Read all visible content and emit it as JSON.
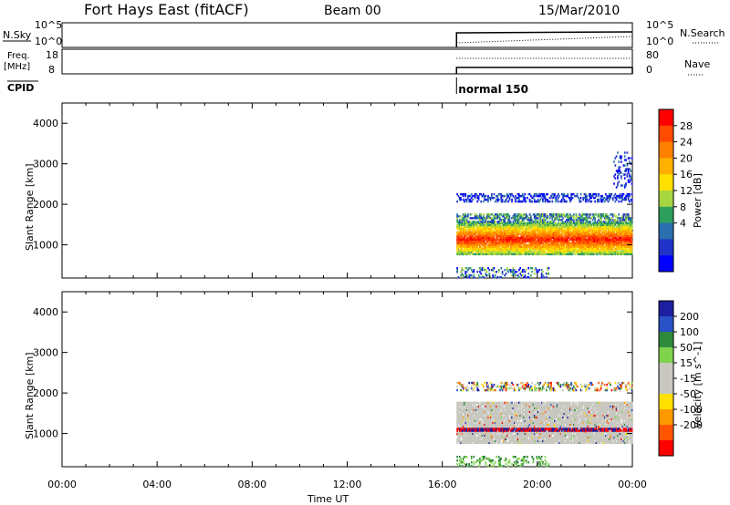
{
  "header": {
    "station": "Fort Hays East (fitACF)",
    "beam": "Beam 00",
    "date": "15/Mar/2010"
  },
  "status": {
    "nsky_label": "N.Sky",
    "nsky_ticks": [
      "10^5",
      "10^0"
    ],
    "nsearch_label": "N.Search",
    "nsearch_ticks": [
      "10^5",
      "10^0"
    ],
    "freq_label_top": "Freq.",
    "freq_label_bottom": "[MHz]",
    "freq_ticks": [
      "18",
      "8"
    ],
    "nave_label": "Nave",
    "nave_ticks": [
      "80",
      "0"
    ],
    "cpid_label": "CPID",
    "cpid_text": "normal 150",
    "cpid_start_hour": 16.6
  },
  "axes": {
    "y_label": "Slant Range [km]",
    "y_ticks": [
      1000,
      2000,
      3000,
      4000
    ],
    "y_range": [
      180,
      4500
    ],
    "x_label": "Time UT",
    "x_ticks": [
      "00:00",
      "04:00",
      "08:00",
      "12:00",
      "16:00",
      "20:00",
      "00:00"
    ],
    "x_range_hours": [
      0,
      24
    ]
  },
  "power_scale": {
    "label": "Power [dB]",
    "ticks": [
      "28",
      "24",
      "20",
      "16",
      "12",
      "8",
      "4"
    ],
    "colors": [
      "#ff0000",
      "#ff4a00",
      "#ff8000",
      "#ffb000",
      "#ffe000",
      "#a6d640",
      "#2e9e5e",
      "#2a6fae",
      "#2032c8",
      "#0000ff"
    ]
  },
  "velocity_scale": {
    "label": "Velocity [m s^-1]",
    "ticks": [
      "200",
      "100",
      "50",
      "15",
      "-15",
      "-50",
      "-100",
      "-200"
    ],
    "colors": [
      "#1e1ea0",
      "#2a52c8",
      "#2f8a3e",
      "#7fd24c",
      "#c8c8c0",
      "#c8c8c0",
      "#ffe000",
      "#ff9900",
      "#ff5500",
      "#ff0000"
    ]
  },
  "chart_data": [
    {
      "type": "heatmap",
      "title": "Power",
      "xlabel": "Time UT",
      "ylabel": "Slant Range [km]",
      "xlim_hours": [
        0,
        24
      ],
      "ylim": [
        180,
        4500
      ],
      "colorbar": "Power [dB]",
      "regions": [
        {
          "t0": 16.6,
          "t1": 24,
          "r0": 750,
          "r1": 1550,
          "feature": "strong band 20-28 dB centred near 1100 km"
        },
        {
          "t0": 16.6,
          "t1": 24,
          "r0": 1550,
          "r1": 1750,
          "feature": "weaker 8-16 dB echoes"
        },
        {
          "t0": 16.6,
          "t1": 24,
          "r0": 2050,
          "r1": 2250,
          "feature": "sparse low-power echoes"
        },
        {
          "t0": 16.6,
          "t1": 20.5,
          "r0": 180,
          "r1": 450,
          "feature": "sparse near-range echoes"
        },
        {
          "t0": 23.2,
          "t1": 24,
          "r0": 2400,
          "r1": 3300,
          "feature": "scattered echoes"
        }
      ]
    },
    {
      "type": "heatmap",
      "title": "Velocity",
      "xlabel": "Time UT",
      "ylabel": "Slant Range [km]",
      "xlim_hours": [
        0,
        24
      ],
      "ylim": [
        180,
        4500
      ],
      "colorbar": "Velocity [m s^-1]",
      "regions": [
        {
          "t0": 16.6,
          "t1": 24,
          "r0": 750,
          "r1": 1750,
          "feature": "mostly -15 to 15 m/s (ground scatter grey)"
        },
        {
          "t0": 16.6,
          "t1": 24,
          "r0": 1050,
          "r1": 1120,
          "feature": "thin line of high +/- velocities"
        },
        {
          "t0": 16.6,
          "t1": 24,
          "r0": 2050,
          "r1": 2250,
          "feature": "sparse mixed velocities"
        },
        {
          "t0": 16.6,
          "t1": 20.5,
          "r0": 180,
          "r1": 450,
          "feature": "sparse near-range echoes"
        }
      ]
    }
  ]
}
